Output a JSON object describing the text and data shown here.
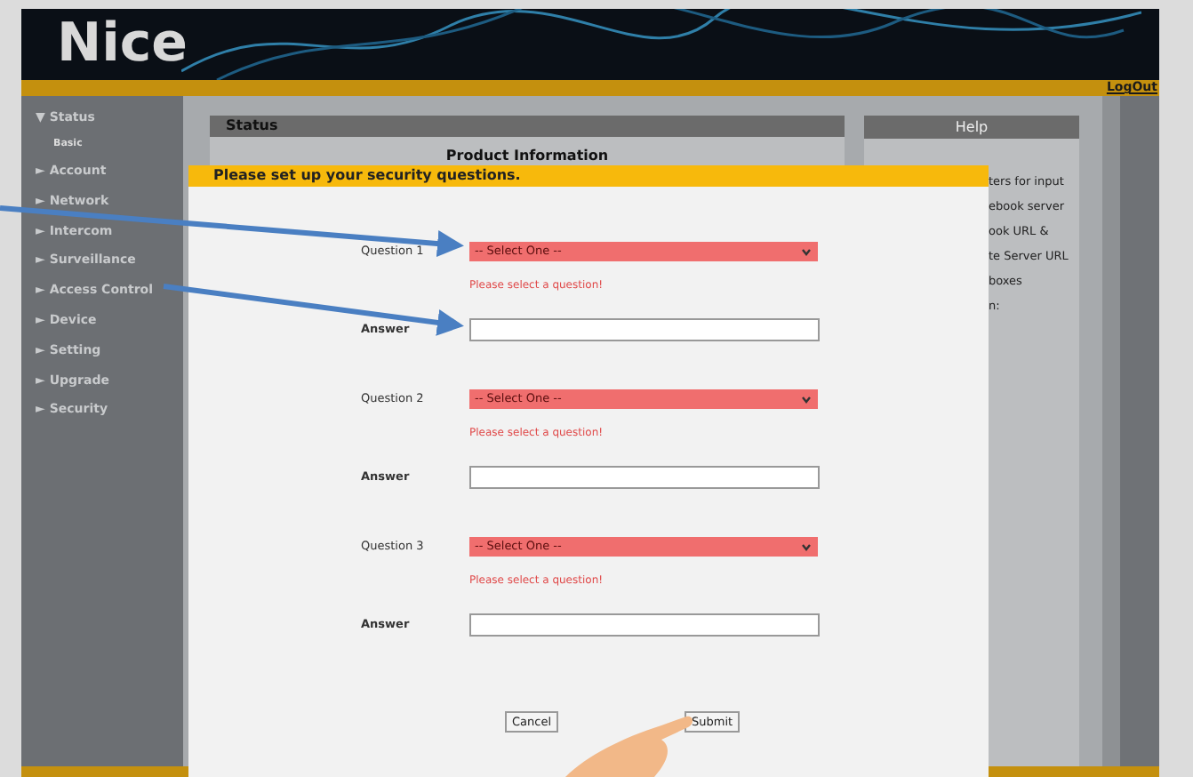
{
  "header": {
    "logo": "Nice",
    "logout": "LogOut"
  },
  "sidebar": {
    "items": [
      {
        "marker": "▼",
        "label": "Status",
        "children": [
          {
            "label": "Basic"
          }
        ]
      },
      {
        "marker": "►",
        "label": "Account"
      },
      {
        "marker": "►",
        "label": "Network"
      },
      {
        "marker": "►",
        "label": "Intercom"
      },
      {
        "marker": "►",
        "label": "Surveillance"
      },
      {
        "marker": "►",
        "label": "Access Control"
      },
      {
        "marker": "►",
        "label": "Device"
      },
      {
        "marker": "►",
        "label": "Setting"
      },
      {
        "marker": "►",
        "label": "Upgrade"
      },
      {
        "marker": "►",
        "label": "Security"
      }
    ]
  },
  "status_panel": {
    "title": "Status",
    "subtitle": "Product Information"
  },
  "help_panel": {
    "title": "Help",
    "visible_lines": [
      "ters for input",
      "ebook server",
      "ook URL &",
      "te Server URL",
      "boxes",
      "n:"
    ]
  },
  "dialog": {
    "title": "Please set up your security questions.",
    "questions": [
      {
        "label": "Question 1",
        "select": "-- Select One --",
        "error": "Please select a question!",
        "answer_label": "Answer"
      },
      {
        "label": "Question 2",
        "select": "-- Select One --",
        "error": "Please select a question!",
        "answer_label": "Answer"
      },
      {
        "label": "Question 3",
        "select": "-- Select One --",
        "error": "Please select a question!",
        "answer_label": "Answer"
      }
    ],
    "buttons": [
      "Cancel",
      "Submit"
    ]
  }
}
